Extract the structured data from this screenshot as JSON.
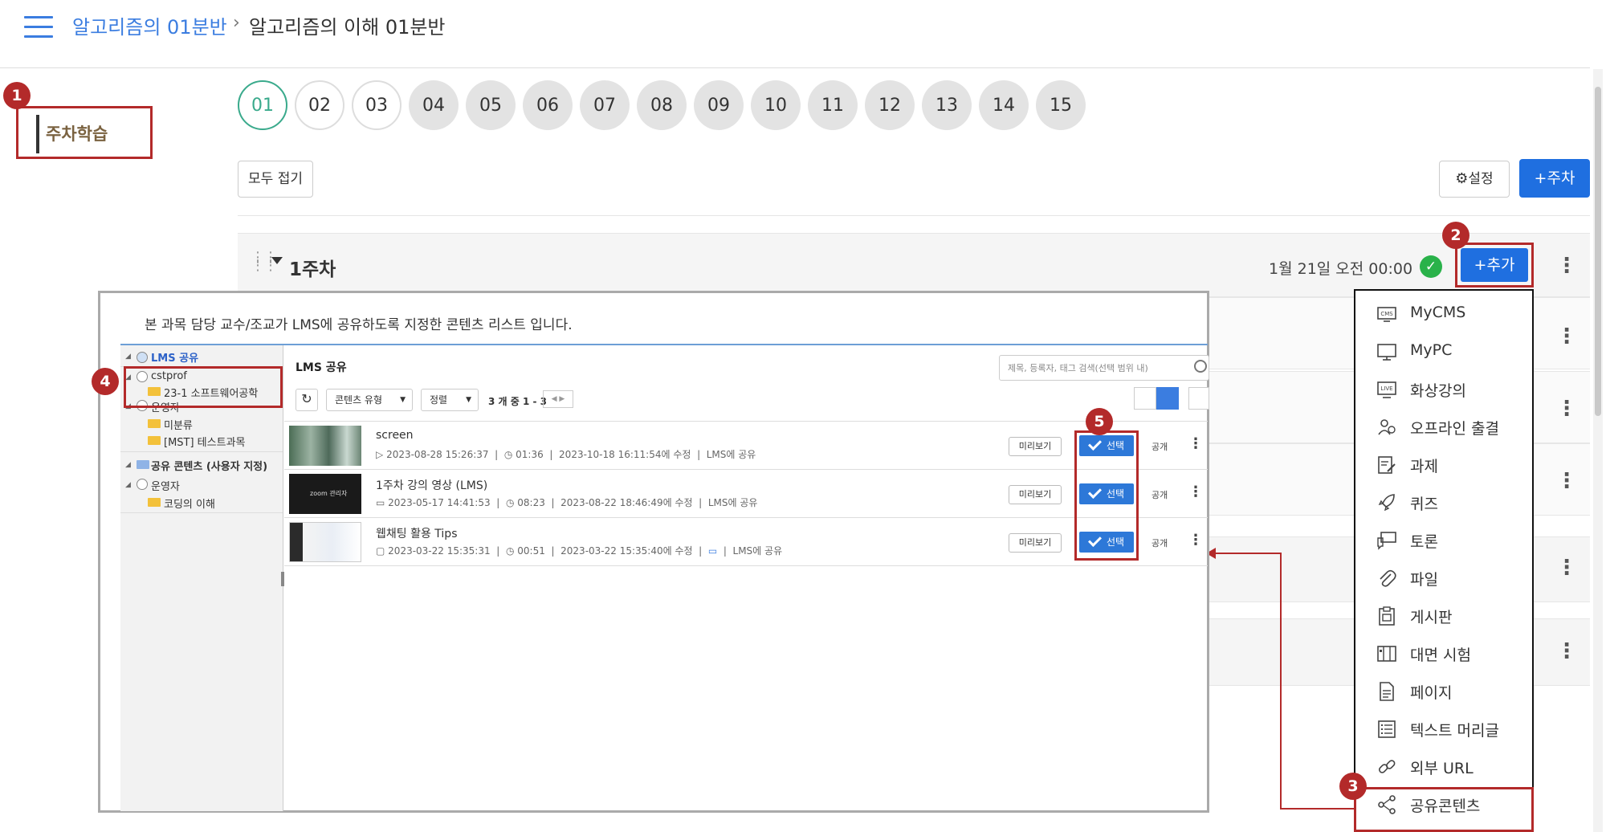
{
  "header": {
    "breadcrumb_course": "알고리즘의 01분반",
    "breadcrumb_sep": "›",
    "breadcrumb_current": "알고리즘의 이해 01분반"
  },
  "nav": {
    "weekly_label": "주차학습"
  },
  "weeks": [
    "01",
    "02",
    "03",
    "04",
    "05",
    "06",
    "07",
    "08",
    "09",
    "10",
    "11",
    "12",
    "13",
    "14",
    "15"
  ],
  "toolbar": {
    "collapse_all": "모두 접기",
    "settings": "설정",
    "add_week": "+주차"
  },
  "week_row": {
    "title": "1주차",
    "date": "1월 21일 오전 00:00",
    "add_button": "+추가"
  },
  "menu": {
    "items": [
      {
        "label": "MyCMS",
        "icon": "cms-icon"
      },
      {
        "label": "MyPC",
        "icon": "monitor-icon"
      },
      {
        "label": "화상강의",
        "icon": "live-icon"
      },
      {
        "label": "오프라인 출결",
        "icon": "attendance-icon"
      },
      {
        "label": "과제",
        "icon": "assignment-icon"
      },
      {
        "label": "퀴즈",
        "icon": "rocket-icon"
      },
      {
        "label": "토론",
        "icon": "discussion-icon"
      },
      {
        "label": "파일",
        "icon": "paperclip-icon"
      },
      {
        "label": "게시판",
        "icon": "clipboard-icon"
      },
      {
        "label": "대면 시험",
        "icon": "exam-icon"
      },
      {
        "label": "페이지",
        "icon": "page-icon"
      },
      {
        "label": "텍스트 머리글",
        "icon": "list-icon"
      },
      {
        "label": "외부 URL",
        "icon": "link-icon"
      },
      {
        "label": "공유콘텐츠",
        "icon": "share-icon"
      }
    ]
  },
  "badges": [
    "1",
    "2",
    "3",
    "4",
    "5"
  ],
  "overlay": {
    "description": "본 과목 담당 교수/조교가 LMS에 공유하도록 지정한 콘텐츠 리스트 입니다.",
    "tree": {
      "root": "LMS 공유",
      "owner1": "cstprof",
      "folder1": "23-1 소프트웨어공학",
      "owner2": "운영자",
      "folder2": "미분류",
      "folder3": "[MST] 테스트과목",
      "root2": "공유 콘텐츠 (사용자 지정)",
      "owner3": "운영자",
      "folder4": "코딩의 이해"
    },
    "main_title": "LMS 공유",
    "search_placeholder": "제목, 등록자, 태그 검색(선택 범위 내)",
    "filter_type": "콘텐츠 유형",
    "filter_sort": "정렬",
    "count": "3 개 중 1 - 3",
    "items": [
      {
        "title": "screen",
        "created": "2023-08-28 15:26:37",
        "duration": "01:36",
        "modified": "2023-10-18 16:11:54에 수정",
        "shared": "LMS에 공유",
        "preview": "미리보기",
        "select": "선택",
        "visibility": "공개"
      },
      {
        "title": "1주차 강의 영상 (LMS)",
        "created": "2023-05-17 14:41:53",
        "duration": "08:23",
        "modified": "2023-08-22 18:46:49에 수정",
        "shared": "LMS에 공유",
        "preview": "미리보기",
        "select": "선택",
        "visibility": "공개"
      },
      {
        "title": "웹채팅 활용 Tips",
        "created": "2023-03-22 15:35:31",
        "duration": "00:51",
        "modified": "2023-03-22 15:35:40에 수정",
        "shared": "LMS에 공유",
        "preview": "미리보기",
        "select": "선택",
        "visibility": "공개"
      }
    ],
    "thumb2_text": "zoom 관리자"
  },
  "colors": {
    "accent_blue": "#1f6fe0",
    "highlight_red": "#b32a2a",
    "active_green": "#3aaa8c"
  }
}
